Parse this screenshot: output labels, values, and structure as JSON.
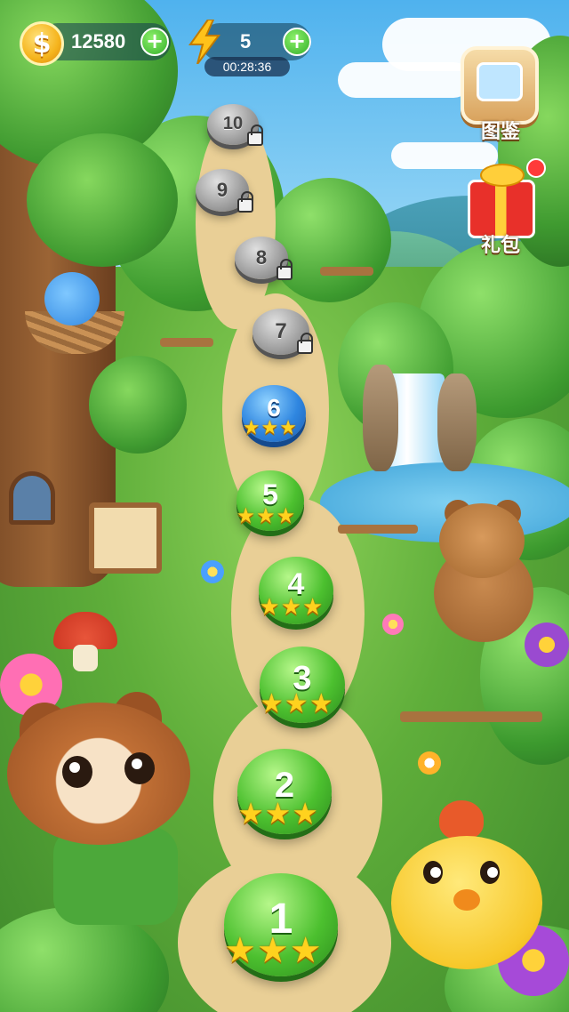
{
  "hud": {
    "coins": "12580",
    "coin_symbol": "$",
    "energy": "5",
    "energy_timer": "00:28:36"
  },
  "side_buttons": {
    "collection_label": "图鉴",
    "gift_label": "礼包",
    "gift_has_notification": true
  },
  "levels": [
    {
      "number": "1",
      "state": "completed",
      "stars": 3
    },
    {
      "number": "2",
      "state": "completed",
      "stars": 3
    },
    {
      "number": "3",
      "state": "completed",
      "stars": 3
    },
    {
      "number": "4",
      "state": "completed",
      "stars": 3
    },
    {
      "number": "5",
      "state": "completed",
      "stars": 3
    },
    {
      "number": "6",
      "state": "current",
      "stars": 3
    },
    {
      "number": "7",
      "state": "locked",
      "stars": 0
    },
    {
      "number": "8",
      "state": "locked",
      "stars": 0
    },
    {
      "number": "9",
      "state": "locked",
      "stars": 0
    },
    {
      "number": "10",
      "state": "locked",
      "stars": 0
    }
  ],
  "colors": {
    "completed": "#4cc02f",
    "current": "#2f86e0",
    "locked": "#9c9c9c",
    "star": "#ffd21e"
  }
}
